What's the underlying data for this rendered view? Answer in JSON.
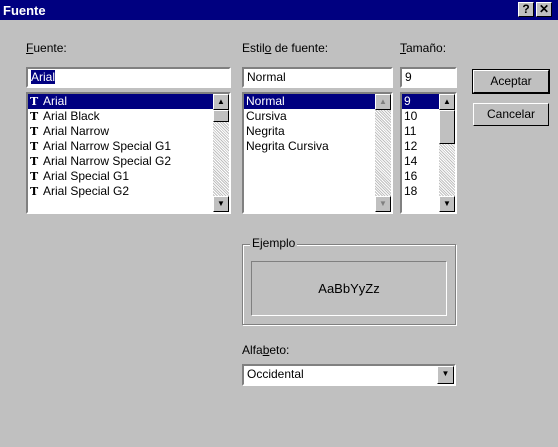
{
  "window": {
    "title": "Fuente",
    "help_glyph": "?",
    "close_glyph": "✕"
  },
  "font": {
    "label_first": "F",
    "label_rest": "uente:",
    "value": "Arial",
    "items": [
      "Arial",
      "Arial Black",
      "Arial Narrow",
      "Arial Narrow Special G1",
      "Arial Narrow Special G2",
      "Arial Special G1",
      "Arial Special G2"
    ],
    "selected_index": 0
  },
  "style": {
    "label_pre": "Estil",
    "label_u": "o",
    "label_post": " de fuente:",
    "value": "Normal",
    "items": [
      "Normal",
      "Cursiva",
      "Negrita",
      "Negrita Cursiva"
    ],
    "selected_index": 0
  },
  "size": {
    "label_first": "T",
    "label_rest": "amaño:",
    "value": "9",
    "items": [
      "9",
      "10",
      "11",
      "12",
      "14",
      "16",
      "18"
    ],
    "selected_index": 0
  },
  "buttons": {
    "ok": "Aceptar",
    "cancel": "Cancelar"
  },
  "sample": {
    "group_label": "Ejemplo",
    "text": "AaBbYyZz"
  },
  "script": {
    "label_pre": "Alfa",
    "label_u": "b",
    "label_post": "eto:",
    "value": "Occidental"
  },
  "icons": {
    "truetype": "truetype-font-icon",
    "dropdown": "chevron-down-icon",
    "scroll_up": "scroll-up-icon",
    "scroll_down": "scroll-down-icon"
  }
}
